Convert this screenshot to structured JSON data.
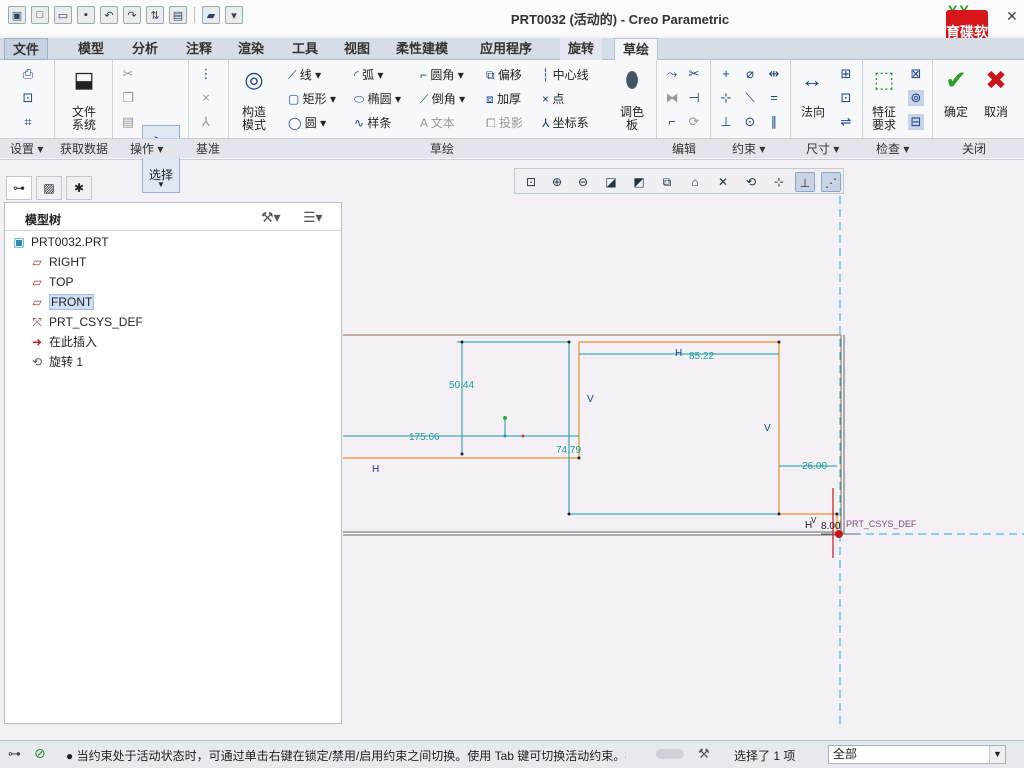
{
  "window": {
    "title": "PRT0032 (活动的) - Creo Parametric",
    "logo_text": "育碟软件",
    "logo_top": "YY"
  },
  "tabs": [
    {
      "label": "文件"
    },
    {
      "label": "模型"
    },
    {
      "label": "分析"
    },
    {
      "label": "注释"
    },
    {
      "label": "渲染"
    },
    {
      "label": "工具"
    },
    {
      "label": "视图"
    },
    {
      "label": "柔性建模"
    },
    {
      "label": "应用程序"
    },
    {
      "label": "旋转"
    },
    {
      "label": "草绘"
    }
  ],
  "ribbon": {
    "groups": {
      "setup": "设置",
      "get_data": "获取数据",
      "operations": "操作",
      "datum": "基准",
      "sketch": "草绘",
      "edit": "编辑",
      "constrain": "约束",
      "dimension": "尺寸",
      "inspect": "检查",
      "close": "关闭"
    },
    "buttons": {
      "file_system": "文件\n系统",
      "select": "选择",
      "construction_mode": "构造\n模式",
      "line": "线",
      "rectangle": "矩形",
      "circle": "圆",
      "arc": "弧",
      "ellipse": "椭圆",
      "spline": "样条",
      "fillet": "圆角",
      "chamfer": "倒角",
      "text": "文本",
      "offset": "偏移",
      "thicken": "加厚",
      "project": "投影",
      "centerline": "中心线",
      "point": "点",
      "coord_sys": "坐标系",
      "palette": "调色\n板",
      "normal": "法向",
      "feature_req": "特征\n要求",
      "ok": "确定",
      "cancel": "取消"
    }
  },
  "model_tree": {
    "title": "模型树",
    "items": [
      {
        "label": "PRT0032.PRT"
      },
      {
        "label": "RIGHT"
      },
      {
        "label": "TOP"
      },
      {
        "label": "FRONT"
      },
      {
        "label": "PRT_CSYS_DEF"
      },
      {
        "label": "在此插入"
      },
      {
        "label": "旋转 1"
      }
    ]
  },
  "sketch": {
    "dims": {
      "d1": "50.44",
      "d2": "175.66",
      "d3": "74.79",
      "d4": "85.22",
      "d5": "26.00",
      "d6": "8.00"
    },
    "labels": {
      "h1": "H",
      "h2": "H",
      "h3": "H",
      "v1": "V",
      "v2": "V",
      "v3": "V",
      "csys": "PRT_CSYS_DEF"
    },
    "colors": {
      "dimension": "#1a9ba0",
      "geometry": "#e8922a",
      "centerline": "#2bb0c8"
    }
  },
  "status": {
    "message": "当约束处于活动状态时，可通过单击右键在锁定/禁用/启用约束之间切换。使用 Tab 键可切换活动约束。按住",
    "selection": "选择了 1 项",
    "filter": "全部"
  }
}
